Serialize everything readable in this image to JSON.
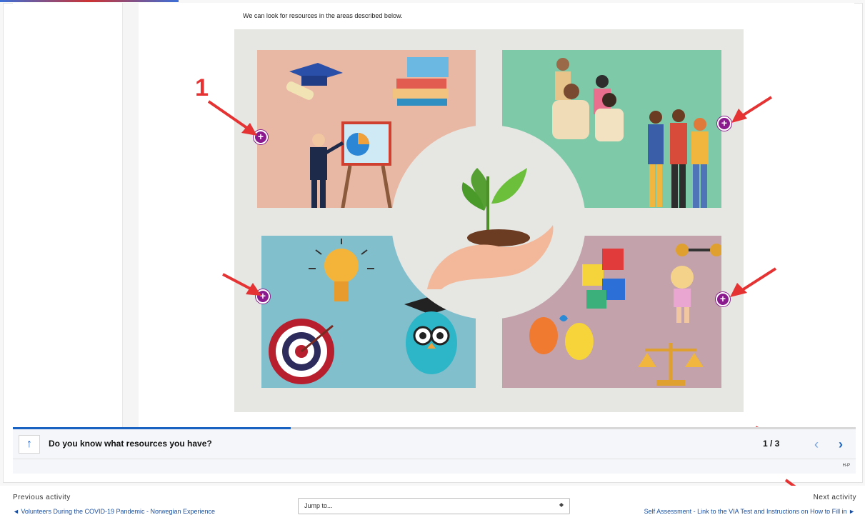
{
  "content": {
    "intro_text": "We can look for resources in the areas described below."
  },
  "annotations": {
    "number_label": "1"
  },
  "hotspots": [
    "+",
    "+",
    "+",
    "+"
  ],
  "footer": {
    "up_icon": "↑",
    "slide_title": "Do you know what resources you have?",
    "counter": "1 / 3",
    "prev_icon": "‹",
    "next_icon": "›",
    "h5p_label": "H-P",
    "progress": 0.33
  },
  "activity_nav": {
    "previous_label": "Previous activity",
    "previous_link": "◄ Volunteers During the COVID-19 Pandemic - Norwegian Experience",
    "jump_placeholder": "Jump to...",
    "next_label": "Next activity",
    "next_link": "Self Assessment - Link to the VIA Test and Instructions on How to Fill in ►"
  },
  "colors": {
    "hotspot": "#8a1a8e",
    "annotation_red": "#e53333",
    "accent_blue": "#1a62c2",
    "quad_education": "#e8b8a4",
    "quad_family": "#7dc9a8",
    "quad_ideas": "#82bfcd",
    "quad_personal": "#c3a2ac"
  }
}
